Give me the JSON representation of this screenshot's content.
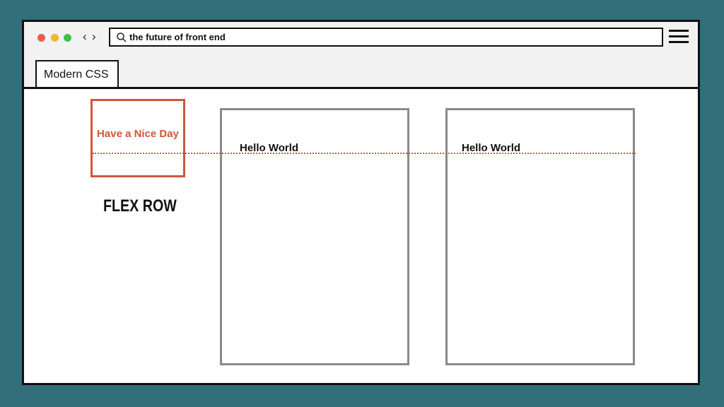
{
  "window": {
    "traffic_lights": [
      "#ec5a52",
      "#f3b42f",
      "#3ec246"
    ]
  },
  "nav": {
    "back_glyph": "‹",
    "forward_glyph": "›"
  },
  "address_bar": {
    "icon": "search-icon",
    "value": "the future of front end"
  },
  "menu": {
    "icon": "hamburger-menu-icon"
  },
  "tab": {
    "label": "Modern CSS"
  },
  "content": {
    "highlight_box": {
      "text": "Have a Nice Day",
      "color": "#d0563a"
    },
    "caption": "FLEX ROW",
    "cards": [
      {
        "text": "Hello World"
      },
      {
        "text": "Hello World"
      }
    ],
    "baseline_color": "#d0563a"
  }
}
